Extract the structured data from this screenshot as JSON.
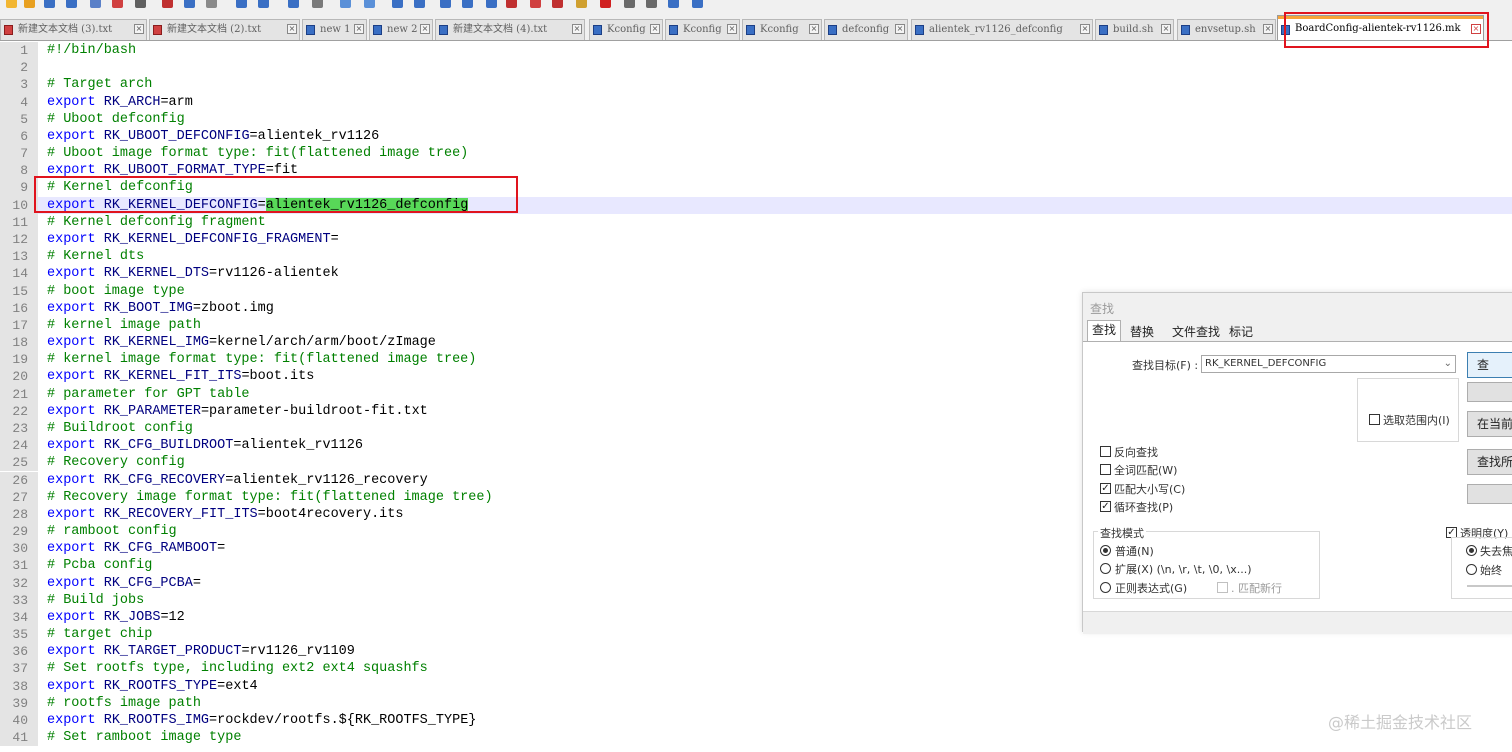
{
  "toolbar": {
    "icons": [
      "new-file-icon",
      "open-icon",
      "save-icon",
      "save-all-icon",
      "close-icon",
      "close-all-icon",
      "print-icon",
      "cut-icon",
      "copy-icon",
      "paste-icon",
      "undo-icon",
      "redo-icon",
      "find-icon",
      "replace-icon",
      "zoom-in-icon",
      "zoom-out-icon",
      "sync-vertical-icon",
      "sync-horizontal-icon",
      "word-wrap-icon",
      "show-all-chars-icon",
      "indent-guide-icon",
      "language-icon",
      "doc-map-icon",
      "function-list-icon",
      "folder-workspace-icon",
      "record-macro-icon",
      "stop-macro-icon",
      "play-macro-icon",
      "run-macro-icon",
      "save-macro-icon"
    ]
  },
  "tabs": [
    {
      "label": "新建文本文档 (3).txt",
      "icon": "red"
    },
    {
      "label": "新建文本文档 (2).txt",
      "icon": "red"
    },
    {
      "label": "new 1",
      "icon": "blue"
    },
    {
      "label": "new 2",
      "icon": "blue"
    },
    {
      "label": "新建文本文档 (4).txt",
      "icon": "blue"
    },
    {
      "label": "Kconfig",
      "icon": "blue"
    },
    {
      "label": "Kconfig",
      "icon": "blue"
    },
    {
      "label": "Kconfig",
      "icon": "blue"
    },
    {
      "label": "defconfig",
      "icon": "blue"
    },
    {
      "label": "alientek_rv1126_defconfig",
      "icon": "blue"
    },
    {
      "label": "build.sh",
      "icon": "blue"
    },
    {
      "label": "envsetup.sh",
      "icon": "blue"
    },
    {
      "label": "BoardConfig-alientek-rv1126.mk",
      "icon": "blue",
      "active": true
    }
  ],
  "editor": {
    "current_line": 10,
    "lines": [
      {
        "n": 1,
        "tokens": [
          [
            "cm",
            "#!/bin/bash"
          ]
        ]
      },
      {
        "n": 2,
        "tokens": []
      },
      {
        "n": 3,
        "tokens": [
          [
            "cm",
            "# Target arch"
          ]
        ]
      },
      {
        "n": 4,
        "tokens": [
          [
            "kw",
            "export"
          ],
          [
            "tx",
            " "
          ],
          [
            "var",
            "RK_ARCH"
          ],
          [
            "tx",
            "=arm"
          ]
        ]
      },
      {
        "n": 5,
        "tokens": [
          [
            "cm",
            "# Uboot defconfig"
          ]
        ]
      },
      {
        "n": 6,
        "tokens": [
          [
            "kw",
            "export"
          ],
          [
            "tx",
            " "
          ],
          [
            "var",
            "RK_UBOOT_DEFCONFIG"
          ],
          [
            "tx",
            "=alientek_rv1126"
          ]
        ]
      },
      {
        "n": 7,
        "tokens": [
          [
            "cm",
            "# Uboot image format type: fit(flattened image tree)"
          ]
        ]
      },
      {
        "n": 8,
        "tokens": [
          [
            "kw",
            "export"
          ],
          [
            "tx",
            " "
          ],
          [
            "var",
            "RK_UBOOT_FORMAT_TYPE"
          ],
          [
            "tx",
            "=fit"
          ]
        ]
      },
      {
        "n": 9,
        "tokens": [
          [
            "cm",
            "# Kernel defconfig"
          ]
        ]
      },
      {
        "n": 10,
        "tokens": [
          [
            "kw",
            "export"
          ],
          [
            "tx",
            " "
          ],
          [
            "var",
            "RK_KERNEL_DEFCONFIG"
          ],
          [
            "tx",
            "="
          ],
          [
            "hl",
            "alientek_rv1126_defconfig"
          ]
        ]
      },
      {
        "n": 11,
        "tokens": [
          [
            "cm",
            "# Kernel defconfig fragment"
          ]
        ]
      },
      {
        "n": 12,
        "tokens": [
          [
            "kw",
            "export"
          ],
          [
            "tx",
            " "
          ],
          [
            "var",
            "RK_KERNEL_DEFCONFIG_FRAGMENT"
          ],
          [
            "tx",
            "="
          ]
        ]
      },
      {
        "n": 13,
        "tokens": [
          [
            "cm",
            "# Kernel dts"
          ]
        ]
      },
      {
        "n": 14,
        "tokens": [
          [
            "kw",
            "export"
          ],
          [
            "tx",
            " "
          ],
          [
            "var",
            "RK_KERNEL_DTS"
          ],
          [
            "tx",
            "=rv1126-alientek"
          ]
        ]
      },
      {
        "n": 15,
        "tokens": [
          [
            "cm",
            "# boot image type"
          ]
        ]
      },
      {
        "n": 16,
        "tokens": [
          [
            "kw",
            "export"
          ],
          [
            "tx",
            " "
          ],
          [
            "var",
            "RK_BOOT_IMG"
          ],
          [
            "tx",
            "=zboot.img"
          ]
        ]
      },
      {
        "n": 17,
        "tokens": [
          [
            "cm",
            "# kernel image path"
          ]
        ]
      },
      {
        "n": 18,
        "tokens": [
          [
            "kw",
            "export"
          ],
          [
            "tx",
            " "
          ],
          [
            "var",
            "RK_KERNEL_IMG"
          ],
          [
            "tx",
            "=kernel/arch/arm/boot/zImage"
          ]
        ]
      },
      {
        "n": 19,
        "tokens": [
          [
            "cm",
            "# kernel image format type: fit(flattened image tree)"
          ]
        ]
      },
      {
        "n": 20,
        "tokens": [
          [
            "kw",
            "export"
          ],
          [
            "tx",
            " "
          ],
          [
            "var",
            "RK_KERNEL_FIT_ITS"
          ],
          [
            "tx",
            "=boot.its"
          ]
        ]
      },
      {
        "n": 21,
        "tokens": [
          [
            "cm",
            "# parameter for GPT table"
          ]
        ]
      },
      {
        "n": 22,
        "tokens": [
          [
            "kw",
            "export"
          ],
          [
            "tx",
            " "
          ],
          [
            "var",
            "RK_PARAMETER"
          ],
          [
            "tx",
            "=parameter-buildroot-fit.txt"
          ]
        ]
      },
      {
        "n": 23,
        "tokens": [
          [
            "cm",
            "# Buildroot config"
          ]
        ]
      },
      {
        "n": 24,
        "tokens": [
          [
            "kw",
            "export"
          ],
          [
            "tx",
            " "
          ],
          [
            "var",
            "RK_CFG_BUILDROOT"
          ],
          [
            "tx",
            "=alientek_rv1126"
          ]
        ]
      },
      {
        "n": 25,
        "tokens": [
          [
            "cm",
            "# Recovery config"
          ]
        ]
      },
      {
        "n": 26,
        "tokens": [
          [
            "kw",
            "export"
          ],
          [
            "tx",
            " "
          ],
          [
            "var",
            "RK_CFG_RECOVERY"
          ],
          [
            "tx",
            "=alientek_rv1126_recovery"
          ]
        ]
      },
      {
        "n": 27,
        "tokens": [
          [
            "cm",
            "# Recovery image format type: fit(flattened image tree)"
          ]
        ]
      },
      {
        "n": 28,
        "tokens": [
          [
            "kw",
            "export"
          ],
          [
            "tx",
            " "
          ],
          [
            "var",
            "RK_RECOVERY_FIT_ITS"
          ],
          [
            "tx",
            "=boot4recovery.its"
          ]
        ]
      },
      {
        "n": 29,
        "tokens": [
          [
            "cm",
            "# ramboot config"
          ]
        ]
      },
      {
        "n": 30,
        "tokens": [
          [
            "kw",
            "export"
          ],
          [
            "tx",
            " "
          ],
          [
            "var",
            "RK_CFG_RAMBOOT"
          ],
          [
            "tx",
            "="
          ]
        ]
      },
      {
        "n": 31,
        "tokens": [
          [
            "cm",
            "# Pcba config"
          ]
        ]
      },
      {
        "n": 32,
        "tokens": [
          [
            "kw",
            "export"
          ],
          [
            "tx",
            " "
          ],
          [
            "var",
            "RK_CFG_PCBA"
          ],
          [
            "tx",
            "="
          ]
        ]
      },
      {
        "n": 33,
        "tokens": [
          [
            "cm",
            "# Build jobs"
          ]
        ]
      },
      {
        "n": 34,
        "tokens": [
          [
            "kw",
            "export"
          ],
          [
            "tx",
            " "
          ],
          [
            "var",
            "RK_JOBS"
          ],
          [
            "tx",
            "=12"
          ]
        ]
      },
      {
        "n": 35,
        "tokens": [
          [
            "cm",
            "# target chip"
          ]
        ]
      },
      {
        "n": 36,
        "tokens": [
          [
            "kw",
            "export"
          ],
          [
            "tx",
            " "
          ],
          [
            "var",
            "RK_TARGET_PRODUCT"
          ],
          [
            "tx",
            "=rv1126_rv1109"
          ]
        ]
      },
      {
        "n": 37,
        "tokens": [
          [
            "cm",
            "# Set rootfs type, including ext2 ext4 squashfs"
          ]
        ]
      },
      {
        "n": 38,
        "tokens": [
          [
            "kw",
            "export"
          ],
          [
            "tx",
            " "
          ],
          [
            "var",
            "RK_ROOTFS_TYPE"
          ],
          [
            "tx",
            "=ext4"
          ]
        ]
      },
      {
        "n": 39,
        "tokens": [
          [
            "cm",
            "# rootfs image path"
          ]
        ]
      },
      {
        "n": 40,
        "tokens": [
          [
            "kw",
            "export"
          ],
          [
            "tx",
            " "
          ],
          [
            "var",
            "RK_ROOTFS_IMG"
          ],
          [
            "tx",
            "=rockdev/rootfs.${RK_ROOTFS_TYPE}"
          ]
        ]
      },
      {
        "n": 41,
        "tokens": [
          [
            "cm",
            "# Set ramboot image type"
          ]
        ]
      }
    ]
  },
  "find_dialog": {
    "title": "查找",
    "tabs": [
      "查找",
      "替换",
      "文件查找",
      "标记"
    ],
    "active_tab": "查找",
    "find_what_label": "查找目标(F) :",
    "find_what_value": "RK_KERNEL_DEFCONFIG",
    "in_selection_label": "选取范围内(I)",
    "buttons": [
      "查",
      "",
      "在当前",
      "查找所",
      ""
    ],
    "options": [
      {
        "label": "反向查找",
        "checked": false
      },
      {
        "label": "全词匹配(W)",
        "checked": false
      },
      {
        "label": "匹配大小写(C)",
        "checked": true
      },
      {
        "label": "循环查找(P)",
        "checked": true
      }
    ],
    "search_mode_title": "查找模式",
    "search_modes": [
      {
        "label": "普通(N)",
        "selected": true
      },
      {
        "label": "扩展(X) (\\n, \\r, \\t, \\0, \\x...)",
        "selected": false
      },
      {
        "label": "正则表达式(G)",
        "selected": false
      }
    ],
    "dot_newline_label": ". 匹配新行",
    "transparency_label": "透明度(Y)",
    "transparency_checked": true,
    "transparency_modes": [
      {
        "label": "失去焦",
        "selected": true
      },
      {
        "label": "始终",
        "selected": false
      }
    ]
  },
  "watermark": "@稀土掘金技术社区",
  "colors": {
    "keyword": "#0000ff",
    "variable": "#000080",
    "comment": "#008000",
    "selection_highlight": "#58d858",
    "current_line": "#e8e8ff",
    "annotation_box": "#e0141e",
    "active_tab_accent": "#f7a43a"
  }
}
